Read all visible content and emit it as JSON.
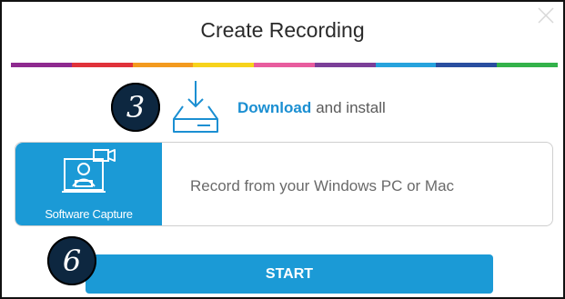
{
  "dialog": {
    "title": "Create Recording"
  },
  "colors": {
    "accent": "#1b9ad6",
    "link": "#1b8fd2",
    "badge": "#0d2740",
    "rainbow": [
      "#8e2a8f",
      "#e0323a",
      "#f39a1e",
      "#f7d31b",
      "#e85c9e",
      "#7b3f98",
      "#27a3dd",
      "#2a4ea0",
      "#33b24a"
    ]
  },
  "download": {
    "link_text": "Download",
    "rest_text": "and install",
    "icon": "download-tray-icon"
  },
  "capture": {
    "tile_label": "Software Capture",
    "description": "Record from your Windows PC or Mac",
    "icon": "screen-capture-icon"
  },
  "start_button": {
    "label": "START"
  },
  "step_badges": {
    "download_step": "3",
    "start_step": "6"
  }
}
